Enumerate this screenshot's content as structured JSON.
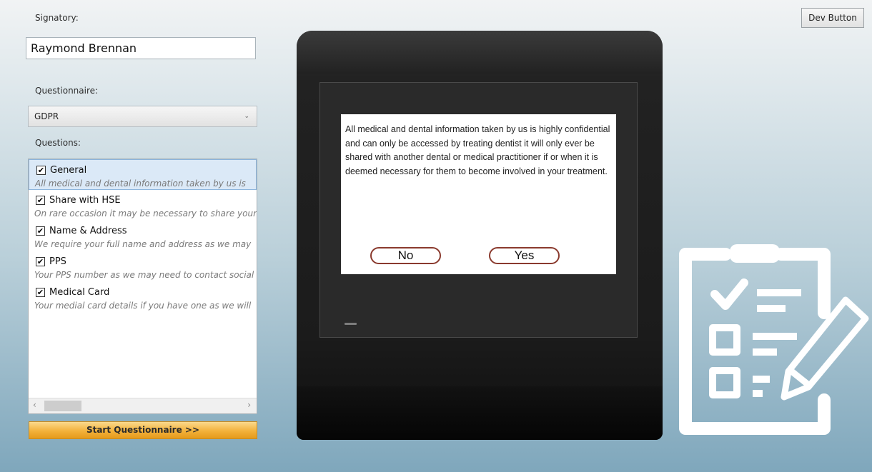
{
  "signatory": {
    "label": "Signatory:",
    "value": "Raymond Brennan"
  },
  "questionnaire": {
    "label": "Questionnaire:",
    "selected": "GDPR"
  },
  "questions": {
    "label": "Questions:",
    "items": [
      {
        "title": "General",
        "checked": true,
        "description": "All medical and dental information taken by us is"
      },
      {
        "title": "Share with HSE",
        "checked": true,
        "description": "On rare occasion it may be necessary to share your"
      },
      {
        "title": "Name & Address",
        "checked": true,
        "description": "We require your full name and address as we may"
      },
      {
        "title": "PPS",
        "checked": true,
        "description": "Your PPS number as we may need to contact social"
      },
      {
        "title": "Medical Card",
        "checked": true,
        "description": "Your medial card details if you have one as we will"
      }
    ]
  },
  "start_button": "Start Questionnaire  >>",
  "dev_button": "Dev Button",
  "signature_pad": {
    "text": "All medical and dental information taken by us is highly confidential and can only be accessed by treating dentist  it will only ever be shared with another dental or medical practitioner if or when it is deemed necessary  for them to become involved in your treatment.",
    "no_label": "No",
    "yes_label": "Yes"
  },
  "colors": {
    "accent_orange": "#f2b13b",
    "pad_button_border": "#8a3a2e",
    "selection": "#dbe9f7"
  },
  "icons": {
    "checkbox": "check-mark",
    "clipboard": "clipboard-checklist-icon"
  }
}
